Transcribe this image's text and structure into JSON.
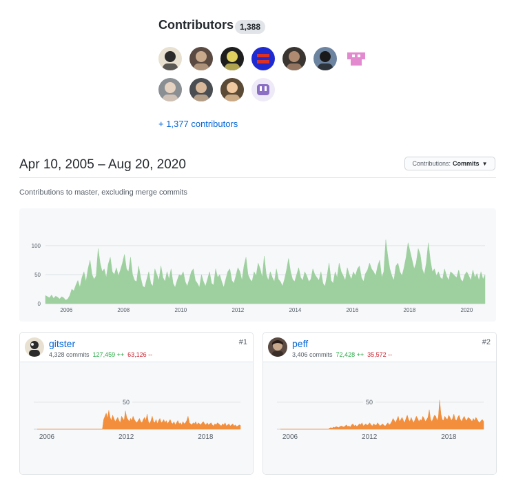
{
  "contributors": {
    "title": "Contributors",
    "count": "1,388",
    "more_link": "+ 1,377 contributors",
    "avatars": [
      {
        "name": "gitster",
        "bg": "#e8e0d0",
        "fg": "#2b2b2b"
      },
      {
        "name": "peff",
        "bg": "#5a4a42",
        "fg": "#c9a98b"
      },
      {
        "name": "contributor-3",
        "bg": "#1e1e1e",
        "fg": "#e0d060"
      },
      {
        "name": "contributor-4",
        "bg": "#1f2bd1",
        "fg": "#e03020"
      },
      {
        "name": "contributor-5",
        "bg": "#3a3530",
        "fg": "#b08a70"
      },
      {
        "name": "contributor-6",
        "bg": "#6d84a0",
        "fg": "#1a1a1a"
      },
      {
        "name": "contributor-7",
        "bg": "#ffffff",
        "fg": "#e389d0"
      },
      {
        "name": "contributor-8",
        "bg": "#8a8f94",
        "fg": "#e6d2c0"
      },
      {
        "name": "contributor-9",
        "bg": "#4a4d52",
        "fg": "#d8b89a"
      },
      {
        "name": "contributor-10",
        "bg": "#5a4a36",
        "fg": "#f0c9a0"
      },
      {
        "name": "contributor-11",
        "bg": "#efeaf7",
        "fg": "#8a6fc5"
      }
    ]
  },
  "header": {
    "date_range": "Apr 10, 2005 – Aug 20, 2020",
    "contrib_button_prefix": "Contributions:",
    "contrib_button_value": "Commits"
  },
  "subtitle": "Contributions to master, excluding merge commits",
  "colors": {
    "main_area": "#9ed09f",
    "user_area": "#f28e3c",
    "grid": "#dfe2e5"
  },
  "chart_data": [
    {
      "type": "area",
      "x_start": 2005.27,
      "x_end": 2020.64,
      "ylim": [
        0,
        100
      ],
      "yticks": [
        0,
        50,
        100
      ],
      "xticks": [
        2006,
        2008,
        2010,
        2012,
        2014,
        2016,
        2018,
        2020
      ],
      "grid": true,
      "values": [
        14,
        12,
        10,
        15,
        9,
        13,
        11,
        8,
        12,
        10,
        6,
        8,
        14,
        25,
        22,
        32,
        40,
        28,
        45,
        55,
        38,
        60,
        75,
        50,
        42,
        48,
        95,
        70,
        55,
        60,
        45,
        68,
        80,
        55,
        50,
        62,
        48,
        58,
        70,
        85,
        60,
        55,
        80,
        50,
        40,
        38,
        65,
        45,
        30,
        28,
        42,
        55,
        35,
        30,
        60,
        50,
        40,
        65,
        45,
        38,
        55,
        42,
        60,
        35,
        28,
        40,
        50,
        48,
        55,
        38,
        30,
        42,
        55,
        60,
        40,
        35,
        28,
        50,
        38,
        30,
        42,
        55,
        35,
        32,
        60,
        45,
        50,
        38,
        28,
        42,
        55,
        60,
        40,
        35,
        48,
        62,
        55,
        40,
        65,
        80,
        50,
        42,
        38,
        55,
        48,
        70,
        60,
        45,
        82,
        50,
        40,
        55,
        45,
        38,
        60,
        42,
        38,
        30,
        42,
        58,
        78,
        55,
        42,
        38,
        50,
        62,
        45,
        40,
        55,
        48,
        38,
        42,
        60,
        50,
        45,
        40,
        55,
        35,
        30,
        48,
        70,
        40,
        35,
        55,
        45,
        70,
        55,
        48,
        40,
        62,
        50,
        42,
        55,
        48,
        60,
        65,
        45,
        38,
        52,
        58,
        70,
        60,
        55,
        48,
        65,
        75,
        45,
        55,
        110,
        82,
        60,
        48,
        40,
        65,
        70,
        55,
        48,
        62,
        80,
        105,
        90,
        75,
        60,
        70,
        95,
        85,
        60,
        50,
        70,
        105,
        75,
        55,
        60,
        48,
        55,
        45,
        42,
        60,
        48,
        40,
        55,
        52,
        48,
        45,
        58,
        42,
        38,
        50,
        55,
        48,
        40,
        58,
        45,
        52,
        40,
        55,
        42,
        50
      ]
    },
    {
      "type": "area",
      "x_start": 2005.27,
      "x_end": 2020.64,
      "ylim": [
        0,
        60
      ],
      "yticks": [
        50
      ],
      "xticks": [
        2006,
        2012,
        2018
      ],
      "grid": true,
      "values": [
        0,
        0,
        0,
        0,
        0,
        0,
        0,
        0,
        0,
        0,
        0,
        0,
        0,
        0,
        0,
        0,
        0,
        0,
        0,
        0,
        0,
        0,
        0,
        0,
        0,
        0,
        0,
        0,
        0,
        0,
        0,
        0,
        0,
        0,
        0,
        0,
        0,
        0,
        0,
        0,
        0,
        0,
        0,
        0,
        0,
        0,
        0,
        0,
        0,
        0,
        0,
        0,
        18,
        24,
        30,
        20,
        35,
        22,
        16,
        26,
        20,
        14,
        18,
        22,
        16,
        12,
        24,
        20,
        16,
        34,
        22,
        18,
        14,
        20,
        16,
        24,
        18,
        14,
        12,
        16,
        20,
        14,
        12,
        18,
        22,
        16,
        28,
        14,
        10,
        16,
        24,
        14,
        12,
        18,
        10,
        16,
        20,
        12,
        14,
        18,
        12,
        16,
        10,
        14,
        18,
        12,
        10,
        14,
        8,
        12,
        16,
        10,
        12,
        8,
        14,
        10,
        12,
        16,
        24,
        12,
        10,
        8,
        12,
        10,
        14,
        8,
        12,
        10,
        8,
        12,
        14,
        10,
        8,
        12,
        8,
        10,
        12,
        8,
        6,
        10,
        8,
        12,
        10,
        8,
        6,
        10,
        8,
        12,
        6,
        8,
        10,
        6,
        8,
        10,
        6,
        8,
        5,
        6,
        8,
        7
      ]
    },
    {
      "type": "area",
      "x_start": 2005.27,
      "x_end": 2020.64,
      "ylim": [
        0,
        60
      ],
      "yticks": [
        50
      ],
      "xticks": [
        2006,
        2012,
        2018
      ],
      "grid": true,
      "values": [
        0,
        0,
        0,
        0,
        0,
        0,
        0,
        0,
        0,
        0,
        0,
        0,
        0,
        0,
        0,
        0,
        0,
        0,
        0,
        0,
        0,
        0,
        0,
        0,
        0,
        0,
        0,
        0,
        0,
        0,
        0,
        0,
        0,
        0,
        0,
        0,
        0,
        0,
        2,
        3,
        2,
        4,
        3,
        5,
        4,
        3,
        5,
        6,
        5,
        4,
        6,
        8,
        5,
        6,
        4,
        8,
        10,
        6,
        8,
        5,
        7,
        10,
        8,
        12,
        6,
        8,
        10,
        7,
        9,
        12,
        8,
        6,
        10,
        8,
        7,
        12,
        9,
        6,
        8,
        10,
        7,
        6,
        9,
        12,
        8,
        10,
        14,
        20,
        16,
        12,
        18,
        24,
        14,
        18,
        22,
        16,
        12,
        20,
        26,
        18,
        14,
        22,
        16,
        12,
        18,
        24,
        20,
        14,
        18,
        16,
        24,
        20,
        14,
        18,
        22,
        36,
        18,
        14,
        20,
        26,
        24,
        16,
        22,
        54,
        28,
        18,
        16,
        24,
        20,
        18,
        26,
        22,
        16,
        20,
        28,
        18,
        16,
        22,
        26,
        18,
        14,
        20,
        24,
        18,
        16,
        22,
        20,
        18,
        14,
        20,
        16,
        22,
        18,
        14,
        12,
        16,
        18,
        14
      ]
    }
  ],
  "cards": [
    {
      "login": "gitster",
      "commits": "4,328 commits",
      "additions": "127,459 ++",
      "deletions": "63,126 --",
      "rank": "#1"
    },
    {
      "login": "peff",
      "commits": "3,406 commits",
      "additions": "72,428 ++",
      "deletions": "35,572 --",
      "rank": "#2"
    }
  ]
}
